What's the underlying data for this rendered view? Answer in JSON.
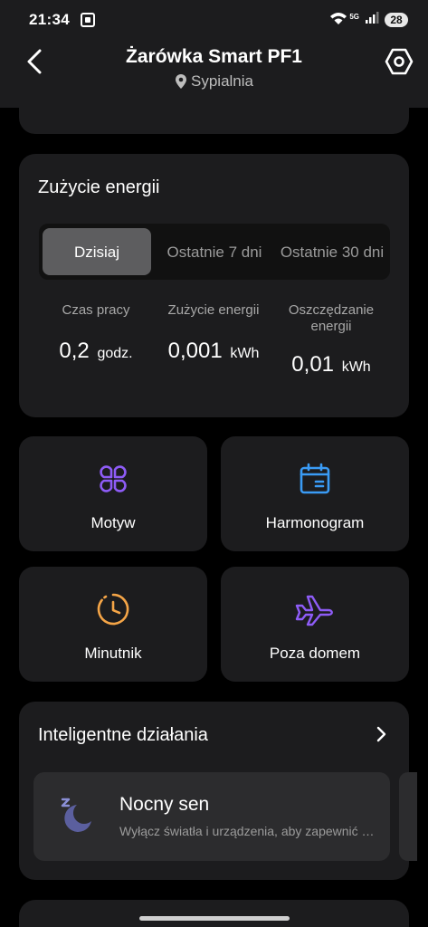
{
  "status_bar": {
    "time": "21:34",
    "network": "5G",
    "battery": "28"
  },
  "header": {
    "title": "Żarówka Smart PF1",
    "room": "Sypialnia"
  },
  "energy": {
    "title": "Zużycie energii",
    "tabs": [
      {
        "label": "Dzisiaj",
        "active": true
      },
      {
        "label": "Ostatnie 7 dni",
        "active": false
      },
      {
        "label": "Ostatnie 30 dni",
        "active": false
      }
    ],
    "stats": [
      {
        "label": "Czas pracy",
        "value": "0,2",
        "unit": "godz."
      },
      {
        "label": "Zużycie energii",
        "value": "0,001",
        "unit": "kWh"
      },
      {
        "label": "Oszczędzanie energii",
        "value": "0,01",
        "unit": "kWh"
      }
    ]
  },
  "tiles": [
    {
      "label": "Motyw",
      "icon": "theme-icon",
      "color": "#8e5cf7"
    },
    {
      "label": "Harmonogram",
      "icon": "calendar-icon",
      "color": "#3a9bf5"
    },
    {
      "label": "Minutnik",
      "icon": "timer-icon",
      "color": "#f5a547"
    },
    {
      "label": "Poza domem",
      "icon": "airplane-icon",
      "color": "#8e5cf7"
    }
  ],
  "smart_actions": {
    "title": "Inteligentne działania",
    "scene": {
      "title": "Nocny sen",
      "description": "Wyłącz światła i urządzenia, aby zapewnić sobie spokojny sen",
      "icon": "sleep-moon-icon"
    }
  },
  "colors": {
    "background": "#000000",
    "card": "#1c1c1e",
    "segment_active": "#5d5d5f"
  }
}
